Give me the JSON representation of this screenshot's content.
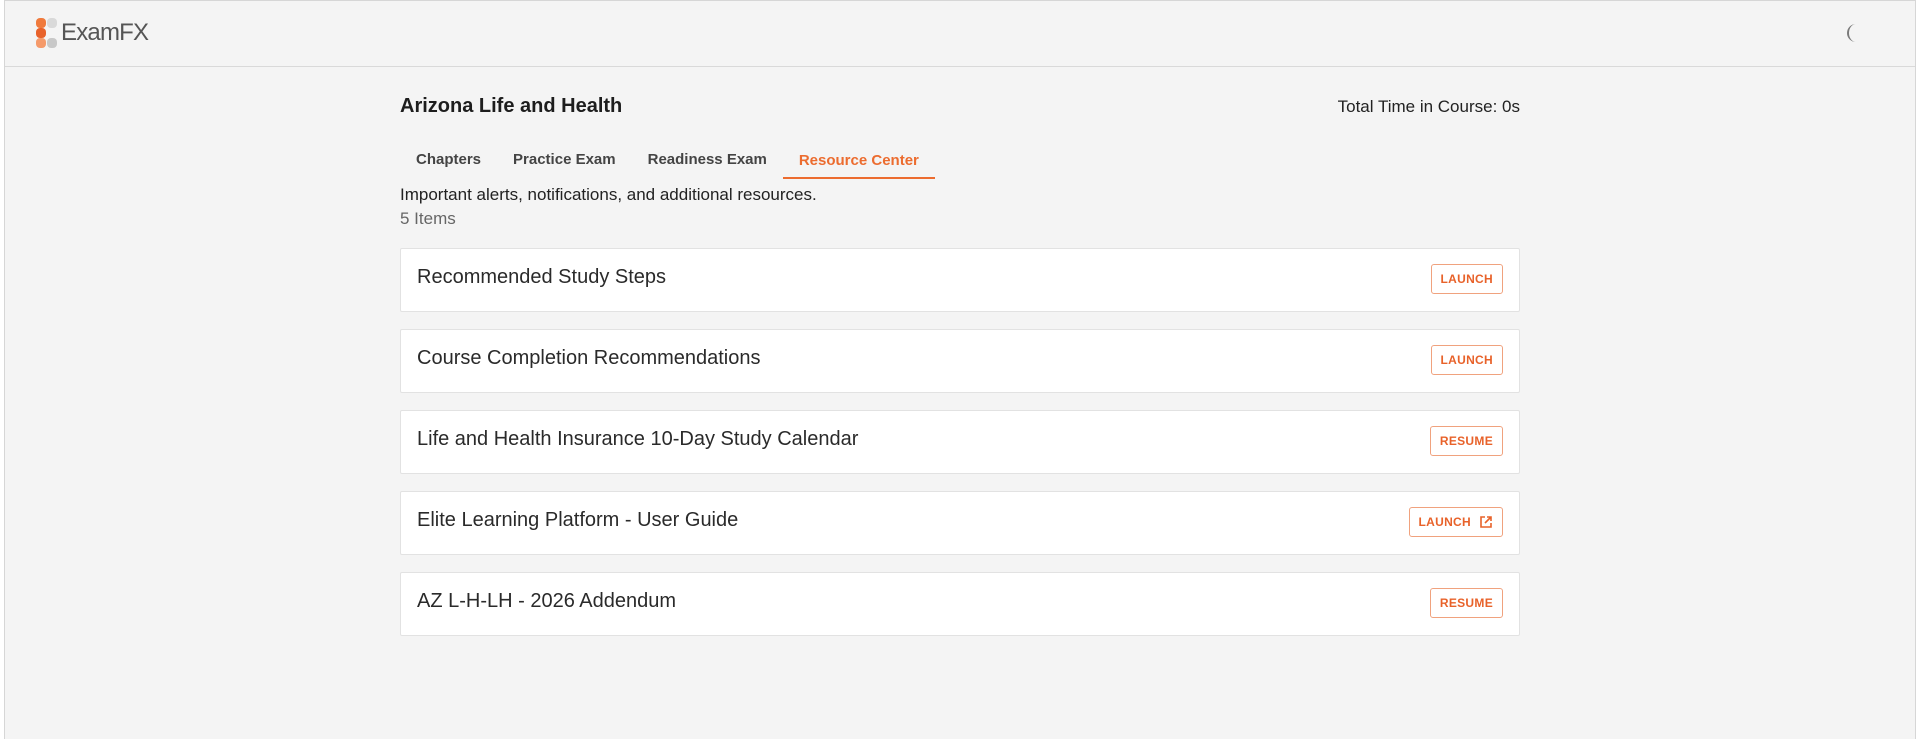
{
  "app": {
    "logo_text": "ExamFX",
    "brand_color": "#ec6c2f",
    "theme_toggle_icon": "moon-icon"
  },
  "course": {
    "title": "Arizona Life and Health",
    "total_time_label": "Total Time in Course: ",
    "total_time_value": "0s"
  },
  "tabs": [
    {
      "label": "Chapters",
      "active": false
    },
    {
      "label": "Practice Exam",
      "active": false
    },
    {
      "label": "Readiness Exam",
      "active": false
    },
    {
      "label": "Resource Center",
      "active": true
    }
  ],
  "resource_center": {
    "description": "Important alerts, notifications, and additional resources.",
    "item_count": "5 Items",
    "items": [
      {
        "title": "Recommended Study Steps",
        "action": "LAUNCH",
        "external": false
      },
      {
        "title": "Course Completion Recommendations",
        "action": "LAUNCH",
        "external": false
      },
      {
        "title": "Life and Health Insurance 10-Day Study Calendar",
        "action": "RESUME",
        "external": false
      },
      {
        "title": "Elite Learning Platform - User Guide",
        "action": "LAUNCH",
        "external": true
      },
      {
        "title": "AZ L-H-LH - 2026 Addendum",
        "action": "RESUME",
        "external": false
      }
    ]
  }
}
